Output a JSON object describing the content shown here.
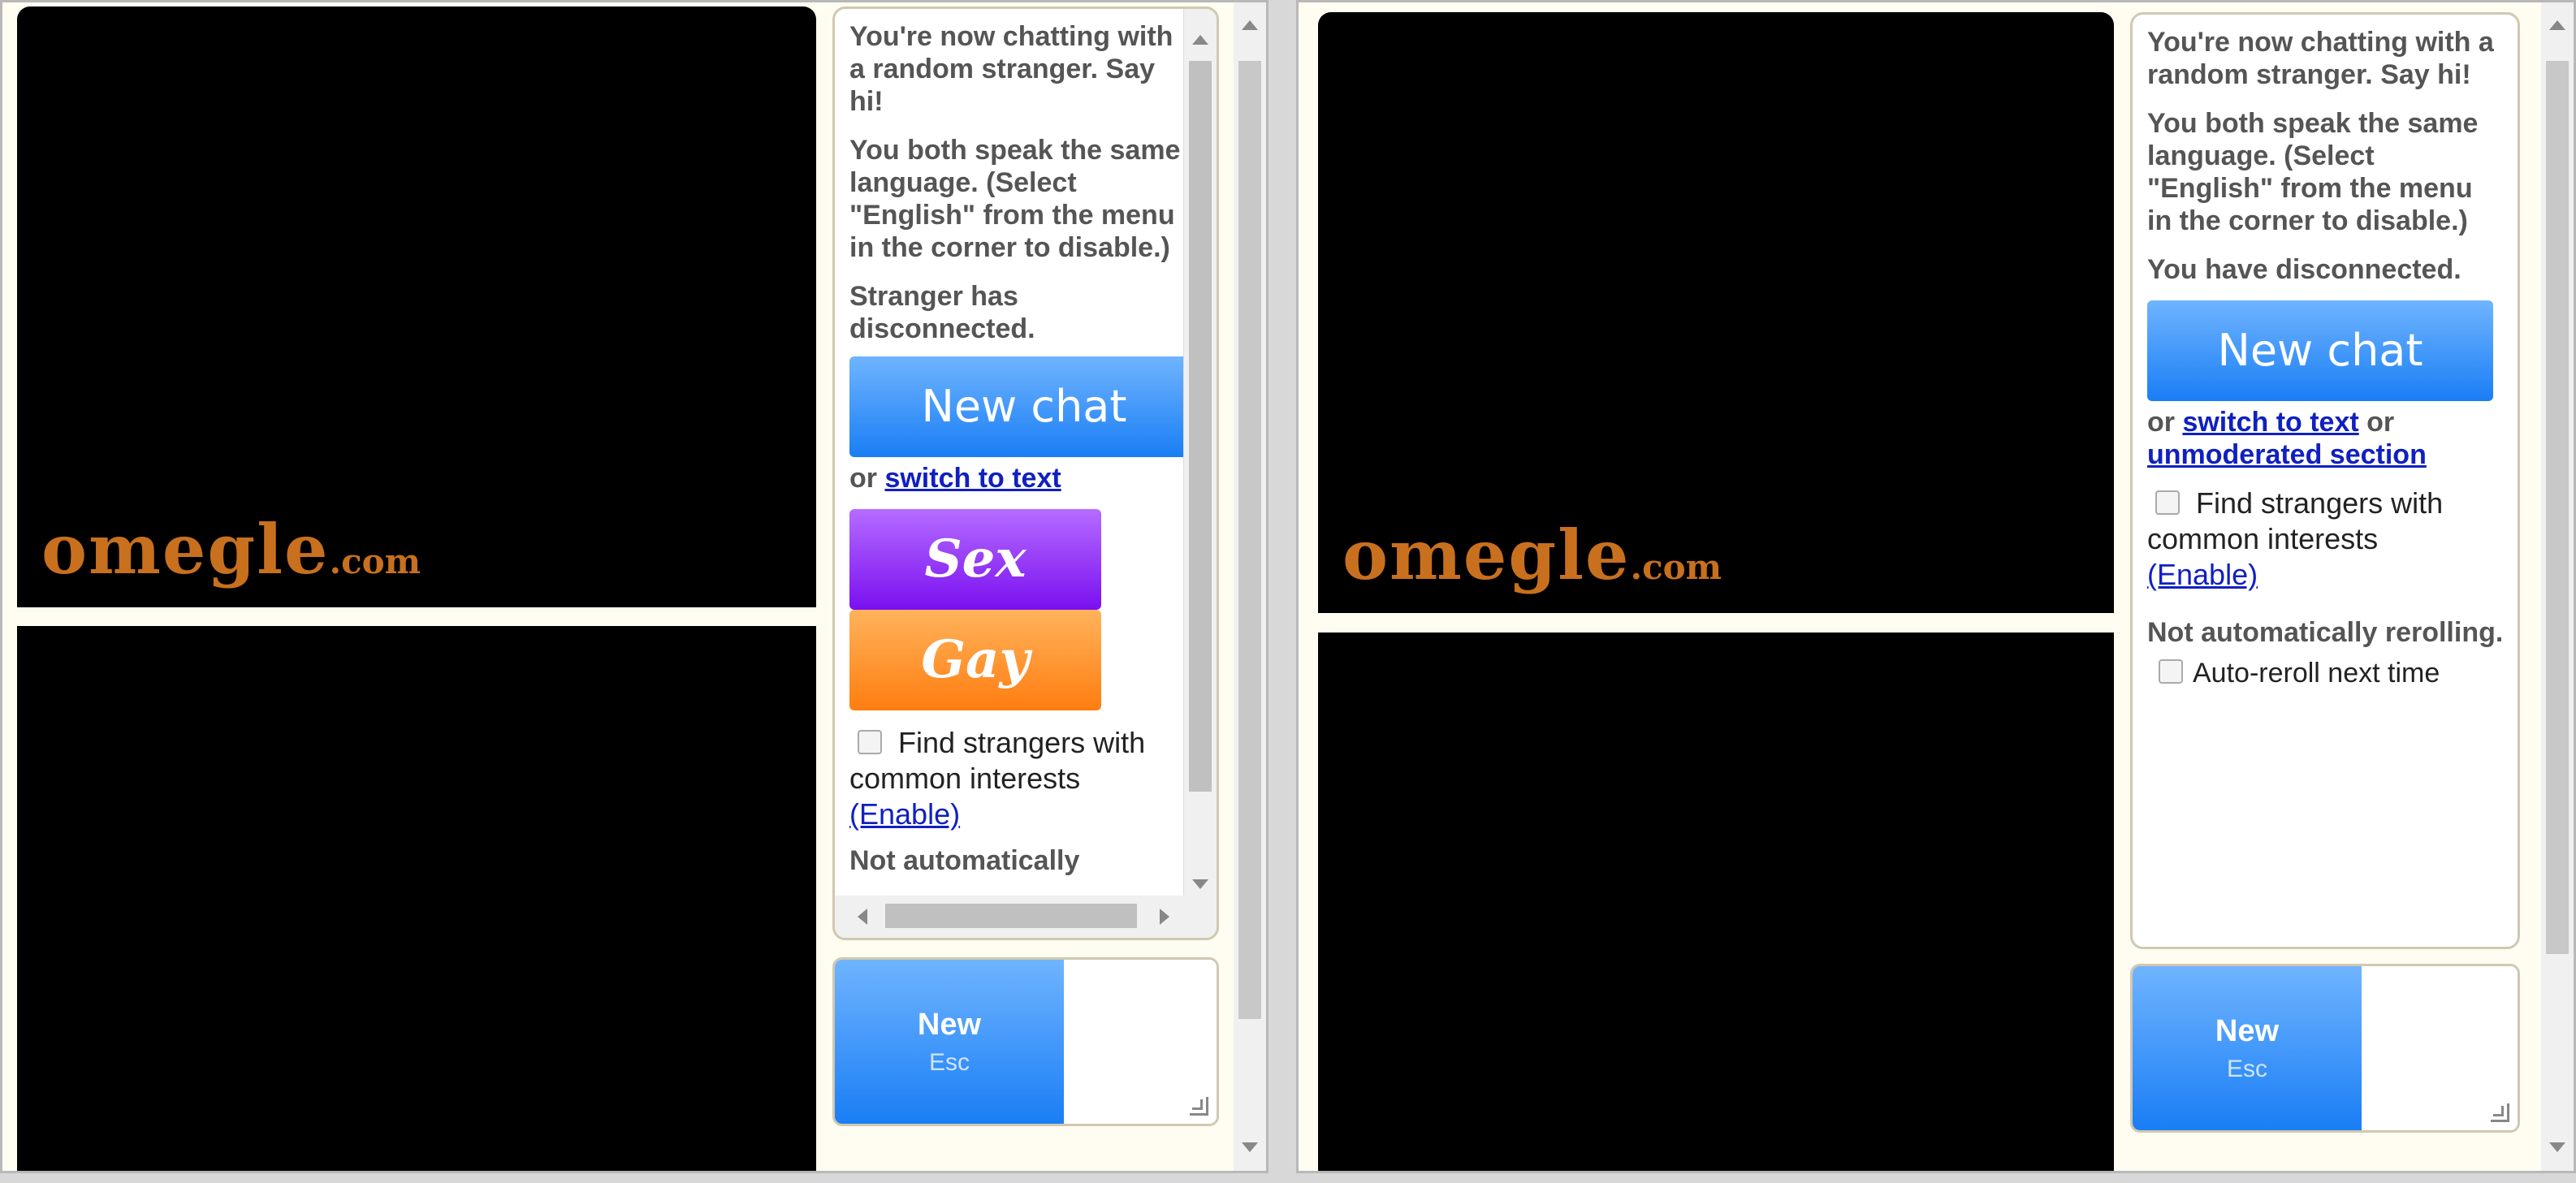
{
  "brand": {
    "logo_main": "omegle",
    "logo_suffix": ".com",
    "logo_color": "#c8701e"
  },
  "left": {
    "messages": [
      "You're now chatting with a random stranger. Say hi!",
      "You both speak the same language. (Select \"English\" from the menu in the corner to disable.)",
      "Stranger has disconnected."
    ],
    "new_chat_label": "New chat",
    "or_prefix": "or",
    "switch_text_link": "switch to text",
    "promo_sex": "Sex",
    "promo_gay": "Gay",
    "interests_label": "Find strangers with common interests",
    "enable_link": "(Enable)",
    "cut_off_text": "Not automatically",
    "send_btn_title": "New",
    "send_btn_sub": "Esc"
  },
  "right": {
    "messages": [
      "You're now chatting with a random stranger. Say hi!",
      "You both speak the same language. (Select \"English\" from the menu in the corner to disable.)",
      "You have disconnected."
    ],
    "new_chat_label": "New chat",
    "or_prefix": "or",
    "switch_text_link": "switch to text",
    "or_mid": "or",
    "unmoderated_link": "unmoderated section",
    "interests_label": "Find strangers with common interests",
    "enable_link": "(Enable)",
    "reroll_status": "Not automatically rerolling.",
    "autoreroll_label": "Auto-reroll next time",
    "send_btn_title": "New",
    "send_btn_sub": "Esc"
  },
  "colors": {
    "button_blue_top": "#6fb4ff",
    "button_blue_bottom": "#1a7ef5",
    "link": "#1020c0"
  }
}
